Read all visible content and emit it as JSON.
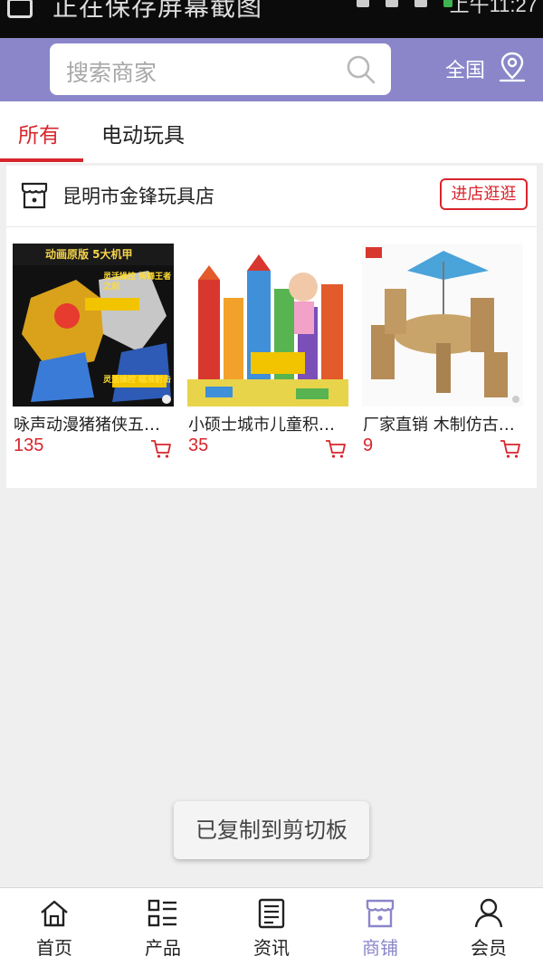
{
  "status_bar": {
    "notification": "正在保存屏幕截图",
    "clock": "上午11:27"
  },
  "header": {
    "search_placeholder": "搜索商家",
    "region": "全国",
    "accent_color": "#8a86c9"
  },
  "tabs": [
    {
      "label": "所有",
      "active": true
    },
    {
      "label": "电动玩具",
      "active": false
    }
  ],
  "store": {
    "name": "昆明市金锋玩具店",
    "enter_label": "进店逛逛",
    "products": [
      {
        "name": "咏声动漫猪猪侠五灵锁玩具",
        "price": "135",
        "image_caption": "动画原版 5大机甲",
        "image_badges": [
          "灵活操控 挥舞王者之剑",
          "灵活操控 瞄准射击"
        ]
      },
      {
        "name": "小硕士城市儿童积木玩具",
        "price": "35"
      },
      {
        "name": "厂家直销 木制仿古桌椅",
        "price": "9"
      }
    ]
  },
  "toast": "已复制到剪切板",
  "bottom_nav": [
    {
      "label": "首页",
      "icon": "home-icon",
      "active": false
    },
    {
      "label": "产品",
      "icon": "grid-list-icon",
      "active": false
    },
    {
      "label": "资讯",
      "icon": "news-icon",
      "active": false
    },
    {
      "label": "商铺",
      "icon": "shop-icon",
      "active": true
    },
    {
      "label": "会员",
      "icon": "user-icon",
      "active": false
    }
  ],
  "colors": {
    "price": "#d8252c",
    "active_tab": "#d8252c",
    "nav_active": "#8a86c9"
  }
}
